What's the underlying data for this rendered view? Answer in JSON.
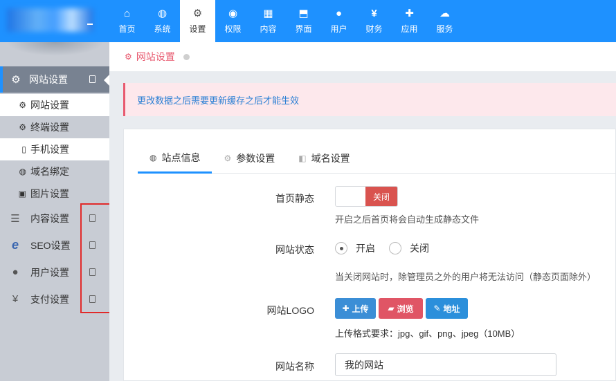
{
  "topnav": {
    "items": [
      {
        "label": "首页",
        "icon": "home-icon"
      },
      {
        "label": "系统",
        "icon": "globe-icon"
      },
      {
        "label": "设置",
        "icon": "gears-icon",
        "active": true
      },
      {
        "label": "权限",
        "icon": "user-circle-icon"
      },
      {
        "label": "内容",
        "icon": "grid-icon"
      },
      {
        "label": "界面",
        "icon": "html5-icon"
      },
      {
        "label": "用户",
        "icon": "user-icon"
      },
      {
        "label": "财务",
        "icon": "yen-icon"
      },
      {
        "label": "应用",
        "icon": "puzzle-icon"
      },
      {
        "label": "服务",
        "icon": "cloud-icon"
      }
    ],
    "colors": {
      "bar": "#1e91ff"
    }
  },
  "sidebar": {
    "group": {
      "label": "网站设置",
      "icon": "gear-icon"
    },
    "subitems": [
      {
        "label": "网站设置",
        "icon": "gear-icon"
      },
      {
        "label": "终端设置",
        "icon": "gears-icon"
      },
      {
        "label": "手机设置",
        "icon": "mobile-icon"
      },
      {
        "label": "域名绑定",
        "icon": "globe-icon"
      },
      {
        "label": "图片设置",
        "icon": "image-icon"
      }
    ],
    "items": [
      {
        "label": "内容设置",
        "icon": "list-icon"
      },
      {
        "label": "SEO设置",
        "icon": "ie-icon"
      },
      {
        "label": "用户设置",
        "icon": "user-icon"
      },
      {
        "label": "支付设置",
        "icon": "yen-icon"
      }
    ]
  },
  "breadcrumb": {
    "label": "网站设置"
  },
  "alert": {
    "text": "更改数据之后需要更新缓存之后才能生效"
  },
  "tabs": [
    {
      "label": "站点信息",
      "icon": "globe-icon",
      "active": true
    },
    {
      "label": "参数设置",
      "icon": "gear-icon"
    },
    {
      "label": "域名设置",
      "icon": "share-icon"
    }
  ],
  "form": {
    "static_home": {
      "label": "首页静态",
      "toggle_label": "关闭",
      "help": "开启之后首页将会自动生成静态文件"
    },
    "site_status": {
      "label": "网站状态",
      "options": [
        "开启",
        "关闭"
      ],
      "selected": "开启",
      "help": "当关闭网站时，除管理员之外的用户将无法访问（静态页面除外）"
    },
    "logo": {
      "label": "网站LOGO",
      "buttons": [
        "上传",
        "浏览",
        "地址"
      ],
      "help": "上传格式要求：jpg、gif、png、jpeg（10MB）"
    },
    "site_name": {
      "label": "网站名称",
      "value": "我的网站"
    }
  }
}
